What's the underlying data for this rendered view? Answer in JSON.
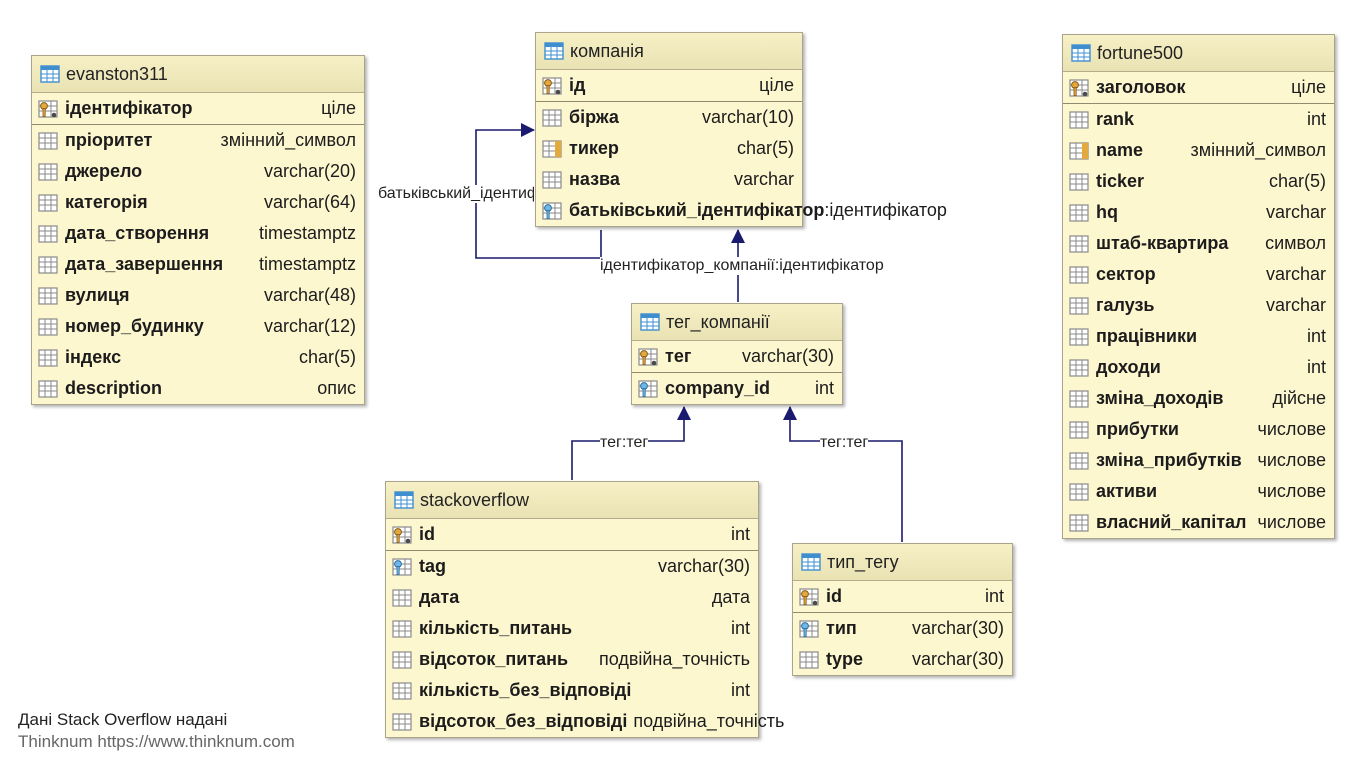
{
  "colors": {
    "table_bg": "#fdf7d0",
    "header_bg": "#efe8bd",
    "edge": "#1a1a6e",
    "icon": "#3f8fd0",
    "key": "#c9933a"
  },
  "tables": {
    "evanston311": {
      "name": "evanston311",
      "columns": [
        {
          "name": "ідентифікатор",
          "type": "ціле",
          "icon": "pk-icon"
        },
        {
          "name": "пріоритет",
          "type": "змінний_символ",
          "icon": "column-icon"
        },
        {
          "name": "джерело",
          "type": "varchar(20)",
          "icon": "column-icon"
        },
        {
          "name": "категорія",
          "type": "varchar(64)",
          "icon": "column-icon"
        },
        {
          "name": "дата_створення",
          "type": "timestamptz",
          "icon": "column-icon"
        },
        {
          "name": "дата_завершення",
          "type": "timestamptz",
          "icon": "column-icon"
        },
        {
          "name": "вулиця",
          "type": "varchar(48)",
          "icon": "column-icon"
        },
        {
          "name": "номер_будинку",
          "type": "varchar(12)",
          "icon": "column-icon"
        },
        {
          "name": "індекс",
          "type": "char(5)",
          "icon": "column-icon"
        },
        {
          "name": "description",
          "type": "опис",
          "icon": "column-icon"
        }
      ]
    },
    "company": {
      "name": "компанія",
      "columns": [
        {
          "name": "ід",
          "type": "ціле",
          "icon": "pk-icon"
        },
        {
          "name": "біржа",
          "type": "varchar(10)",
          "icon": "column-icon"
        },
        {
          "name": "тикер",
          "type": "char(5)",
          "icon": "unique-icon"
        },
        {
          "name": "назва",
          "type": "varchar",
          "icon": "column-icon"
        },
        {
          "name": "батьківський_ідентифікатор",
          "type": ":ідентифікатор",
          "icon": "fk-icon"
        }
      ]
    },
    "fortune500": {
      "name": "fortune500",
      "columns": [
        {
          "name": "заголовок",
          "type": "ціле",
          "icon": "pk-icon"
        },
        {
          "name": "rank",
          "type": "int",
          "icon": "column-icon"
        },
        {
          "name": "name",
          "type": "змінний_символ",
          "icon": "unique-icon"
        },
        {
          "name": "ticker",
          "type": "char(5)",
          "icon": "column-icon"
        },
        {
          "name": "hq",
          "type": "varchar",
          "icon": "column-icon"
        },
        {
          "name": "штаб-квартира",
          "type": "символ",
          "icon": "column-icon"
        },
        {
          "name": "сектор",
          "type": "varchar",
          "icon": "column-icon"
        },
        {
          "name": "галузь",
          "type": "varchar",
          "icon": "column-icon"
        },
        {
          "name": "працівники",
          "type": "int",
          "icon": "column-icon"
        },
        {
          "name": "доходи",
          "type": "int",
          "icon": "column-icon"
        },
        {
          "name": "зміна_доходів",
          "type": "дійсне",
          "icon": "column-icon"
        },
        {
          "name": "прибутки",
          "type": "числове",
          "icon": "column-icon"
        },
        {
          "name": "зміна_прибутків",
          "type": "числове",
          "icon": "column-icon"
        },
        {
          "name": "активи",
          "type": "числове",
          "icon": "column-icon"
        },
        {
          "name": "власний_капітал",
          "type": "числове",
          "icon": "column-icon"
        }
      ]
    },
    "tag_company": {
      "name": "тег_компанії",
      "columns": [
        {
          "name": "тег",
          "type": "varchar(30)",
          "icon": "pk-icon"
        },
        {
          "name": "company_id",
          "type": "int",
          "icon": "fk-icon"
        }
      ]
    },
    "stackoverflow": {
      "name": "stackoverflow",
      "columns": [
        {
          "name": "id",
          "type": "int",
          "icon": "pk-icon"
        },
        {
          "name": "tag",
          "type": "varchar(30)",
          "icon": "fk-icon"
        },
        {
          "name": "дата",
          "type": "дата",
          "icon": "column-icon"
        },
        {
          "name": "кількість_питань",
          "type": "int",
          "icon": "column-icon"
        },
        {
          "name": "відсоток_питань",
          "type": "подвійна_точність",
          "icon": "column-icon"
        },
        {
          "name": "кількість_без_відповіді",
          "type": "int",
          "icon": "column-icon"
        },
        {
          "name": "відсоток_без_відповіді",
          "type": "подвійна_точність",
          "icon": "column-icon"
        }
      ]
    },
    "tag_type": {
      "name": "тип_тегу",
      "columns": [
        {
          "name": "id",
          "type": "int",
          "icon": "pk-icon"
        },
        {
          "name": "тип",
          "type": "varchar(30)",
          "icon": "fk-icon"
        },
        {
          "name": "type",
          "type": "varchar(30)",
          "icon": "column-icon"
        }
      ]
    }
  },
  "edges": {
    "self_ref": "батьківський_ідентифікатор",
    "company_fk": "ідентифікатор_компанії:ідентифікатор",
    "so_tag": "тег:тег",
    "type_tag": "тег:тег"
  },
  "credits": {
    "line1": "Дані Stack Overflow надані",
    "line2": "Thinknum https://www.thinknum.com"
  }
}
